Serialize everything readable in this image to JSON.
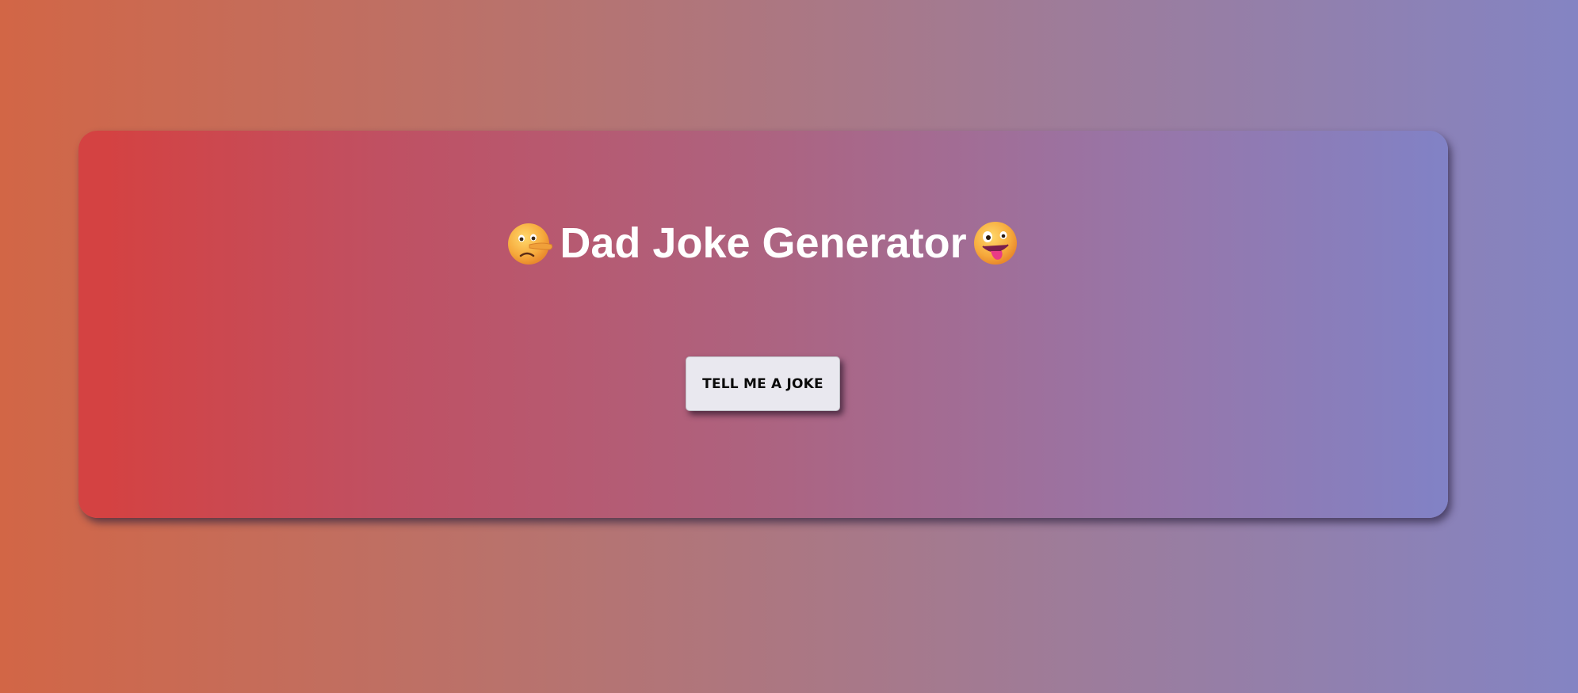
{
  "page": {
    "title": "Dad Joke Generator",
    "left_icon": "lying-face-icon",
    "right_icon": "zany-face-icon"
  },
  "joke_button": {
    "label": "TELL ME A JOKE"
  },
  "colors": {
    "background_gradient": [
      "#d26646",
      "#8484c3"
    ],
    "card_gradient": [
      "#d44242",
      "#8182c6"
    ],
    "title_text": "#ffffff",
    "button_bg": "#e9e8ef",
    "button_text": "#0a0a0a"
  }
}
